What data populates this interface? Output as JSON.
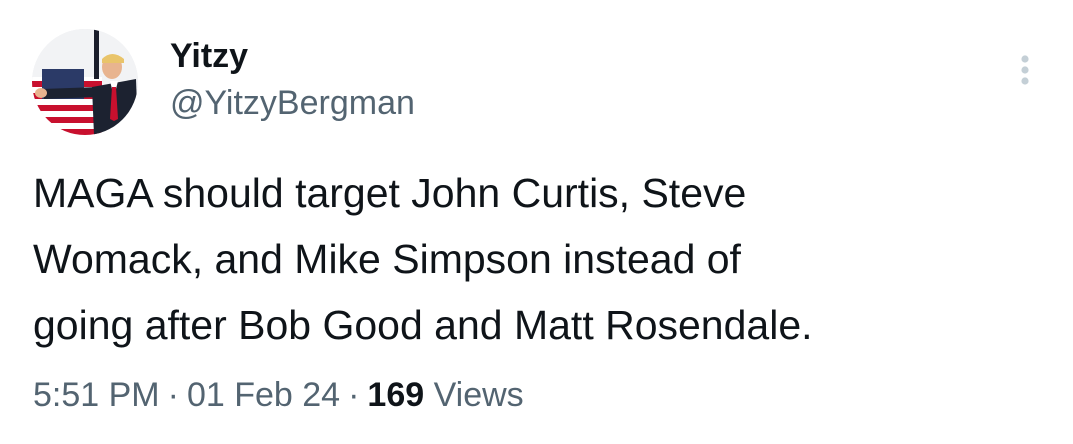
{
  "author": {
    "display_name": "Yitzy",
    "handle": "@YitzyBergman"
  },
  "tweet": {
    "text": "MAGA should target John Curtis, Steve\nWomack, and Mike Simpson instead of\ngoing after Bob Good and Matt Rosendale."
  },
  "meta": {
    "time": "5:51 PM",
    "separator": "·",
    "date": "01 Feb 24",
    "views_count": "169",
    "views_label": "Views"
  },
  "icons": {
    "more": "more-vertical-icon"
  },
  "colors": {
    "primary_text": "#0f1419",
    "secondary_text": "#536471",
    "background": "#ffffff"
  }
}
